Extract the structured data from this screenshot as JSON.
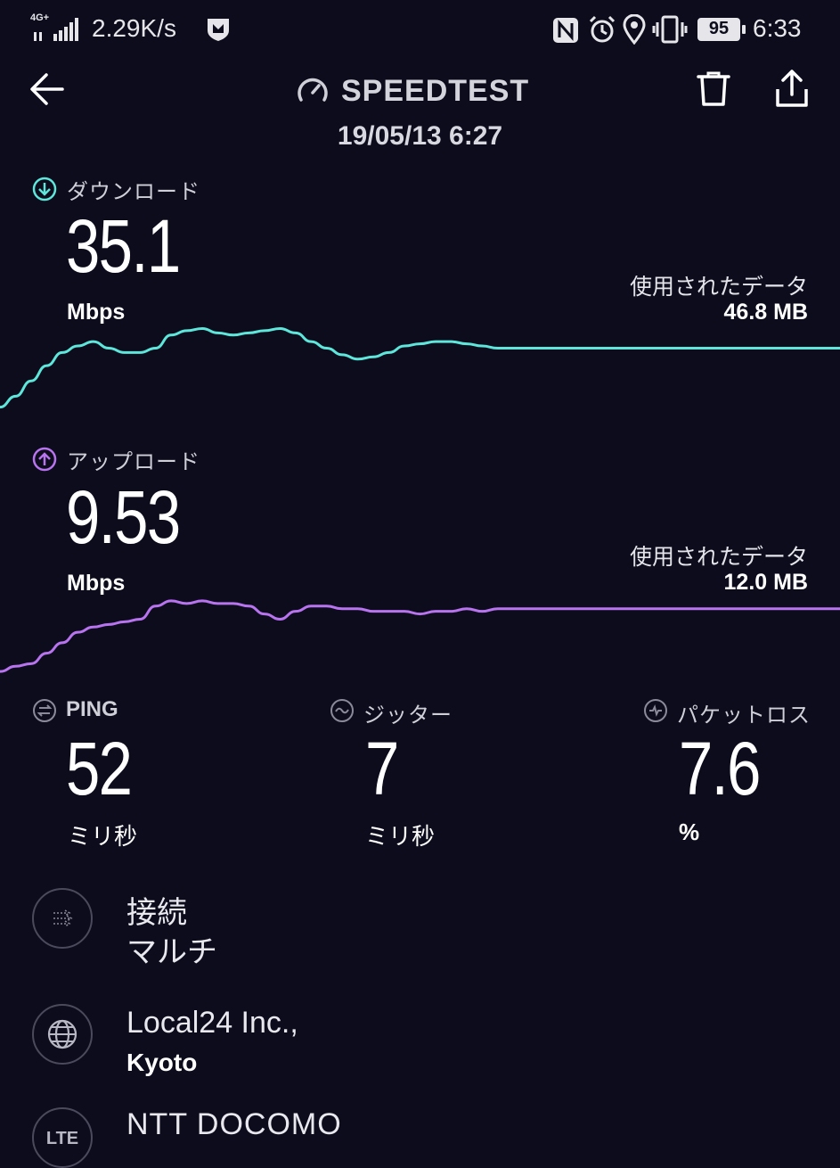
{
  "status_bar": {
    "network_type": "4G+",
    "net_speed": "2.29K/s",
    "battery_level": "95",
    "time": "6:33"
  },
  "header": {
    "title": "SPEEDTEST",
    "timestamp": "19/05/13 6:27"
  },
  "download": {
    "label": "ダウンロード",
    "value": "35.1",
    "unit": "Mbps",
    "data_used_label": "使用されたデータ",
    "data_used_value": "46.8 MB",
    "color": "#5ee6da",
    "trace": [
      3,
      8,
      15,
      22,
      28,
      31,
      33,
      30,
      28,
      28,
      30,
      36,
      38,
      39,
      37,
      36,
      37,
      38,
      39,
      37,
      33,
      30,
      27,
      25,
      26,
      28,
      31,
      32,
      33,
      33,
      32,
      31,
      30,
      30,
      30,
      30,
      30,
      30,
      30,
      30,
      30,
      30,
      30,
      30,
      30,
      30,
      30,
      30,
      30,
      30,
      30,
      30,
      30,
      30,
      30
    ]
  },
  "upload": {
    "label": "アップロード",
    "value": "9.53",
    "unit": "Mbps",
    "data_used_label": "使用されたデータ",
    "data_used_value": "12.0 MB",
    "color": "#b873ee",
    "trace": [
      2,
      4,
      5,
      9,
      13,
      17,
      19,
      20,
      21,
      22,
      27,
      29,
      28,
      29,
      28,
      28,
      27,
      24,
      22,
      25,
      27,
      27,
      26,
      26,
      25,
      25,
      25,
      24,
      25,
      25,
      26,
      25,
      26,
      26,
      26,
      26,
      26,
      26,
      26,
      26,
      26,
      26,
      26,
      26,
      26,
      26,
      26,
      26,
      26,
      26,
      26,
      26,
      26,
      26,
      26
    ]
  },
  "ping": {
    "label": "PING",
    "value": "52",
    "unit": "ミリ秒"
  },
  "jitter": {
    "label": "ジッター",
    "value": "7",
    "unit": "ミリ秒"
  },
  "packet_loss": {
    "label": "パケットロス",
    "value": "7.6",
    "unit": "%"
  },
  "connection": {
    "title": "接続",
    "value": "マルチ"
  },
  "server": {
    "name": "Local24 Inc.,",
    "location": "Kyoto"
  },
  "provider": {
    "badge": "LTE",
    "name": "NTT DOCOMO"
  },
  "icons": {
    "back": "arrow-left-icon",
    "speedometer": "speedometer-icon",
    "delete": "trash-icon",
    "share": "share-icon"
  }
}
